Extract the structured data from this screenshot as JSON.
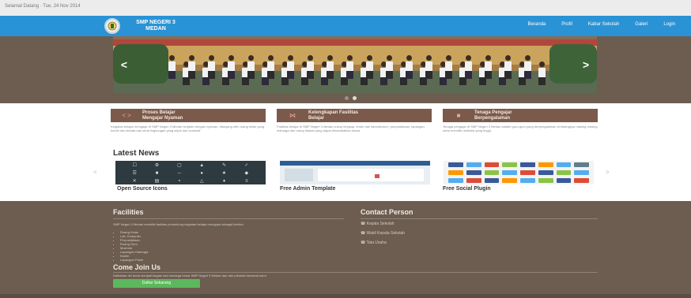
{
  "topbar": {
    "text": "Selamat Datang · Tue, 24 Nov 2014"
  },
  "navbar": {
    "brand_line1": "SMP NEGERI 3",
    "brand_line2": "MEDAN",
    "menu": [
      "Beranda",
      "Profil",
      "Kabar Sekolah",
      "Galeri",
      "Login"
    ],
    "accent": "#2a93d5"
  },
  "hero": {
    "prev_icon": "chevron-left-icon",
    "next_icon": "chevron-right-icon",
    "slides_count": 2,
    "active_slide": 2
  },
  "features": [
    {
      "icon": "code-brackets-icon",
      "title_line1": "Proses Belajar",
      "title_line2": "Mengajar Nyaman",
      "text": "Kegiatan belajar mengajar di SMP Negeri 3 Medan berjalan dengan nyaman, ditunjang oleh ruang kelas yang bersih dan tertata rapi serta lingkungan yang sejuk dan kondusif."
    },
    {
      "icon": "network-icon",
      "title_line1": "Kelengkapan Fasilitas",
      "title_line2": "Belajar",
      "text": "Fasilitas belajar di SMP Negeri 3 Medan cukup lengkap, terdiri dari laboratorium, perpustakaan, lapangan olahraga dan ruang ibadah yang dapat dimanfaatkan siswa."
    },
    {
      "icon": "teacher-icon",
      "title_line1": "Tenaga Pengajar",
      "title_line2": "Berpengalaman",
      "text": "Tenaga pengajar di SMP Negeri 3 Medan adalah guru-guru yang berpengalaman di bidangnya masing-masing serta memiliki dedikasi yang tinggi."
    }
  ],
  "news": {
    "title": "Latest News",
    "items": [
      {
        "label": "Open Source Icons"
      },
      {
        "label": "Free Admin Template"
      },
      {
        "label": "Free Social Plugin"
      }
    ],
    "prev_icon": "chevron-left-icon",
    "next_icon": "chevron-right-icon"
  },
  "facilities": {
    "title": "Facilities",
    "intro": "SMP Negeri 3 Medan memiliki fasilitas pendukung kegiatan belajar mengajar sebagai berikut:",
    "items": [
      "Ruang Kelas",
      "Lab. Komputer",
      "Perpustakaan",
      "Ruang Guru",
      "Mushola",
      "Lapangan Olahraga",
      "Kantin",
      "Lapangan Parkir"
    ]
  },
  "contact": {
    "title": "Contact Person",
    "items": [
      "Kepala Sekolah",
      "Wakil Kepala Sekolah",
      "Tata Usaha"
    ]
  },
  "join": {
    "title": "Come Join Us",
    "text": "Daftarkan diri anda menjadi bagian dari keluarga besar SMP Negeri 3 Medan dan raih prestasi bersama kami.",
    "button": "Daftar Sekarang"
  },
  "colors": {
    "brown": "#6c5d50",
    "feature_head": "#7b5a4b",
    "button": "#5cb85c"
  }
}
